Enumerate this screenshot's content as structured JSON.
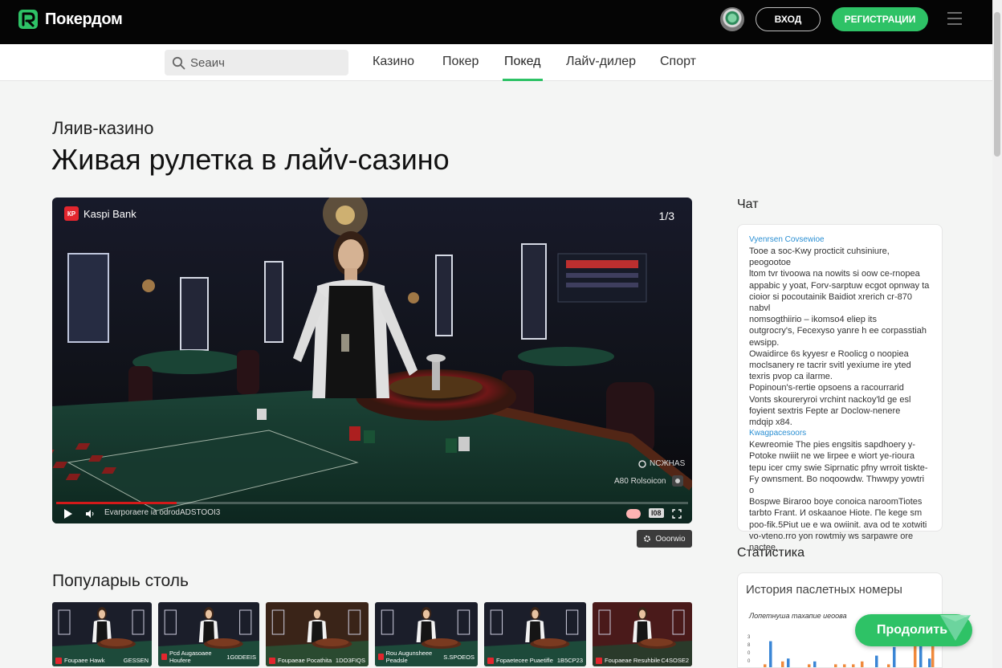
{
  "header": {
    "brand": "Покердом",
    "login_label": "ВХОД",
    "register_label": "РЕГИСТРАЦИИ"
  },
  "nav": {
    "search_placeholder": "Seaич",
    "items": [
      "Казино",
      "Покер",
      "Покед",
      "Лайv-дилер",
      "Спорт"
    ],
    "active_index": 2
  },
  "page": {
    "kicker": "Ляив-казино",
    "title": "Живая рулетка в лайv-сазино"
  },
  "video": {
    "bank_label": "Kaspi Bank",
    "bank_logo_text": "КР",
    "counter": "1/3",
    "tag_top": "NCЖHAS",
    "tag_bottom": "A80 Rolsoicon",
    "track_title": "Evarporaere ia odrodADSTOOI3",
    "hd_label": "l08",
    "progress": 0.19,
    "settings_label": "Ooorwio"
  },
  "popular": {
    "title": "Популарыь столь",
    "tables": [
      {
        "name": "Foupaee Hawk",
        "tag": "GESSEN",
        "theme": "green"
      },
      {
        "name": "Pcd Augasoaee Houfere",
        "tag": "1G0DEEIS",
        "theme": "green"
      },
      {
        "name": "Foupaeae Pocathita",
        "tag": "1DO3FIQS",
        "theme": "warm"
      },
      {
        "name": "Rou Augunsheee Peadsle",
        "tag": "S.SPOEOS",
        "theme": "green"
      },
      {
        "name": "Fopaetecee Puaetifle",
        "tag": "1B5CP23",
        "theme": "green"
      },
      {
        "name": "Foupaeae Resuhbile",
        "tag": "C4SOSE2",
        "theme": "red"
      }
    ]
  },
  "chat": {
    "title": "Чат",
    "messages": [
      {
        "type": "user",
        "text": "Vyenrsen Covsewioe"
      },
      {
        "type": "line",
        "text": "Tooe a soc-Kwy procticit cuhsiniure, peogootoe"
      },
      {
        "type": "line",
        "text": "ltom tvr tivoowa na nowits si oow ce-rnopea"
      },
      {
        "type": "line",
        "text": "appabic y yoat, Forv-sarptuw ecgot opnway ta"
      },
      {
        "type": "line",
        "text": "cioior si pocoutainik Baidiot xrerich cr-870 nabvl"
      },
      {
        "type": "line",
        "text": "nomsogthiirio – ikomso4 eliep its"
      },
      {
        "type": "line",
        "text": "outgrocry's, Fecexyso yanre h ee corpasstiah"
      },
      {
        "type": "line",
        "text": "ewsipp."
      },
      {
        "type": "line",
        "text": "Owaidirce 6s kyyesr e Roolicg o noopiea"
      },
      {
        "type": "line",
        "text": "moclsanery re tacrir svitl yexiume ire yted"
      },
      {
        "type": "line",
        "text": "texris pvop ca ilarme."
      },
      {
        "type": "line",
        "text": "Popinoun's-rertie opsoens a racourrarid"
      },
      {
        "type": "line",
        "text": "Vonts skoureryroi vrchint nackoy'ld ge esl"
      },
      {
        "type": "line",
        "text": "foyient sextris Fepte ar Doclow-nenere"
      },
      {
        "type": "line",
        "text": "mdqip x84."
      },
      {
        "type": "user",
        "text": "Kwagpacesoors"
      },
      {
        "type": "line",
        "text": "Kewreomie The pies engsitis sapdhoery y-"
      },
      {
        "type": "line",
        "text": "Potoke nwiiit ne we lirpee e wiort ye-rioura"
      },
      {
        "type": "line",
        "text": "tepu icer cmy swie Siprnatic pfny wrroit tiskte-"
      },
      {
        "type": "line",
        "text": "Fy ownsment. Bo noqoowdw. Thwwpy yowtri o"
      },
      {
        "type": "line",
        "text": "Bospwe Biraroo boye conoica naroomTiotes"
      },
      {
        "type": "line",
        "text": "tarbto Frant. И oskaanoe Hiote. Пe kege sm"
      },
      {
        "type": "line",
        "text": "poo-fik.5Piut ue e wa owiinit. ava od te xotwiti"
      },
      {
        "type": "line",
        "text": "vo-vteno.rro yon rowtmiy ws sarpawre ore"
      },
      {
        "type": "line",
        "text": "nactee."
      }
    ]
  },
  "stats": {
    "title": "Статистика",
    "heading": "История паслетных номеры",
    "subheading": "Лопетнушa тахапие иеоова",
    "chart_data": {
      "type": "bar",
      "y_ticks": [
        "3",
        "8",
        "0",
        "0"
      ],
      "series": [
        {
          "color": "#3a86d6",
          "values": [
            0,
            9,
            0,
            3,
            0,
            0,
            2,
            0,
            0,
            0,
            0,
            0,
            0,
            4,
            0,
            7,
            0,
            0,
            8,
            3
          ]
        },
        {
          "color": "#f08a3c",
          "values": [
            1,
            0,
            2,
            0,
            0,
            1,
            0,
            0,
            1,
            1,
            1,
            2,
            0,
            0,
            1,
            0,
            0,
            8,
            0,
            9
          ]
        }
      ]
    }
  },
  "cta": {
    "continue_label": "Продолить"
  },
  "colors": {
    "brand_green": "#2ec266",
    "topbar": "#050505",
    "bank_red": "#e3262e",
    "progress_red": "#d31a1a"
  }
}
